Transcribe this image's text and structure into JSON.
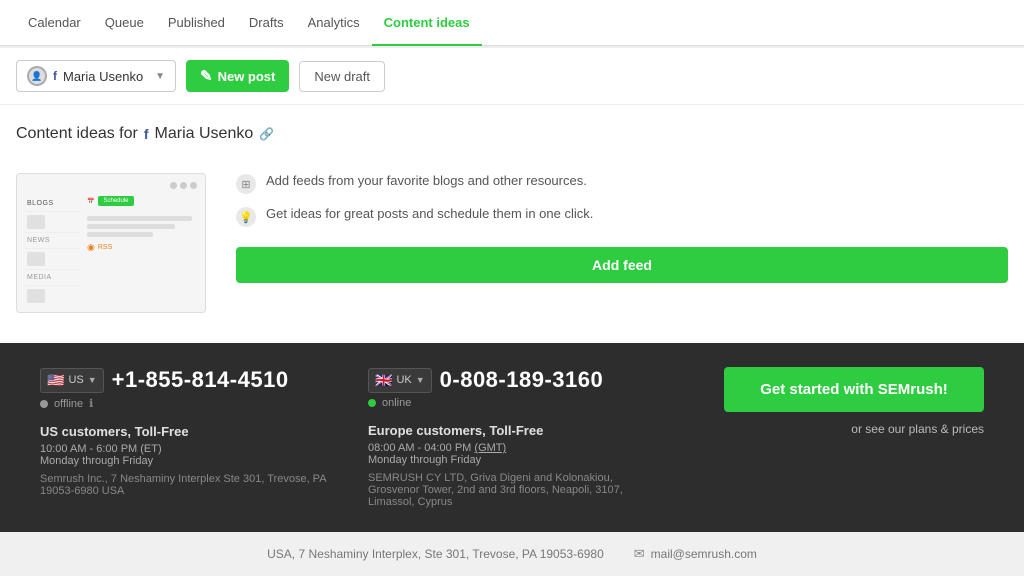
{
  "nav": {
    "items": [
      {
        "label": "Calendar",
        "id": "calendar",
        "active": false
      },
      {
        "label": "Queue",
        "id": "queue",
        "active": false
      },
      {
        "label": "Published",
        "id": "published",
        "active": false
      },
      {
        "label": "Drafts",
        "id": "drafts",
        "active": false
      },
      {
        "label": "Analytics",
        "id": "analytics",
        "active": false
      },
      {
        "label": "Content ideas",
        "id": "content-ideas",
        "active": true
      }
    ]
  },
  "toolbar": {
    "account_name": "Maria Usenko",
    "new_post_label": "New post",
    "new_draft_label": "New draft"
  },
  "main": {
    "content_ideas_title": "Content ideas for",
    "account_name": "Maria Usenko",
    "features": [
      {
        "icon": "rss-icon",
        "text": "Add feeds from your favorite blogs and other resources."
      },
      {
        "icon": "bulb-icon",
        "text": "Get ideas for great posts and schedule them in one click."
      }
    ],
    "add_feed_label": "Add feed"
  },
  "preview": {
    "blogs_label": "BLOGS",
    "news_label": "NEWS",
    "media_label": "MEDIA",
    "schedule_label": "Schedule",
    "rss_label": "RSS"
  },
  "footer_dark": {
    "us": {
      "flag": "🇺🇸",
      "country": "US",
      "phone": "+1-855-814-4510",
      "status": "offline",
      "status_label": "offline",
      "info_icon": "ℹ",
      "title": "US customers, Toll-Free",
      "hours": "10:00 AM - 6:00 PM (ET)",
      "hours_note": "(ET)",
      "days": "Monday through Friday",
      "address": "Semrush Inc., 7 Neshaminy Interplex Ste 301, Trevose, PA 19053-6980 USA"
    },
    "uk": {
      "flag": "🇬🇧",
      "country": "UK",
      "phone": "0-808-189-3160",
      "status": "online",
      "status_label": "online",
      "title": "Europe customers, Toll-Free",
      "hours": "08:00 AM - 04:00 PM",
      "hours_gmt": "(GMT)",
      "days": "Monday through Friday",
      "address": "SEMRUSH CY LTD, Griva Digeni and Kolonakiou, Grosvenor Tower, 2nd and 3rd floors, Neapoli, 3107, Limassol, Cyprus"
    },
    "cta": {
      "button_label": "Get started with SEMrush!",
      "plans_label": "or see our plans & prices"
    }
  },
  "footer_light": {
    "address": "USA, 7 Neshaminy Interplex, Ste 301, Trevose, PA 19053-6980",
    "email": "mail@semrush.com"
  }
}
